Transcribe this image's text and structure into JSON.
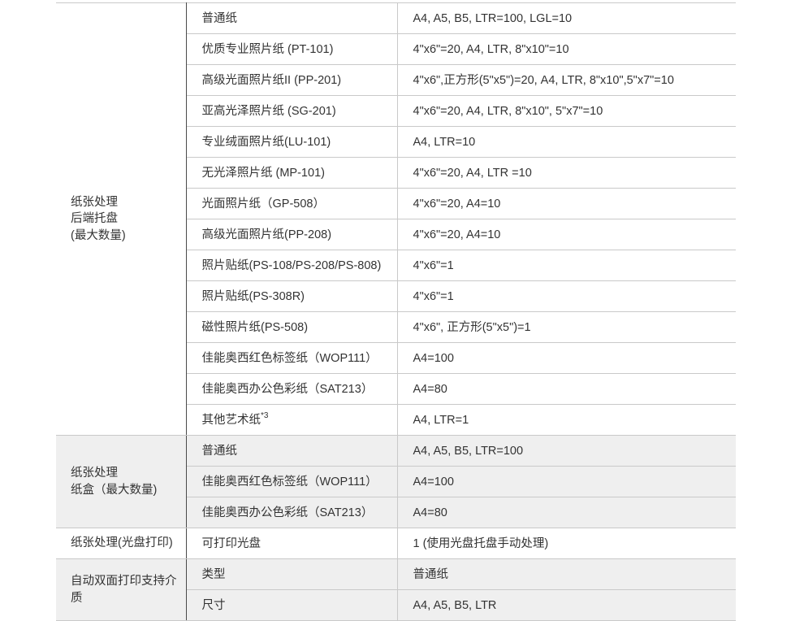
{
  "groups": [
    {
      "label_lines": [
        "纸张处理",
        "后端托盘",
        "(最大数量)"
      ],
      "rows": [
        {
          "item": "普通纸",
          "value": "A4, A5, B5, LTR=100, LGL=10"
        },
        {
          "item": "优质专业照片纸 (PT-101)",
          "value": "4\"x6\"=20, A4, LTR, 8\"x10\"=10"
        },
        {
          "item": "高级光面照片纸II (PP-201)",
          "value": "4\"x6\",正方形(5\"x5\")=20, A4, LTR,  8\"x10\",5\"x7\"=10"
        },
        {
          "item": "亚高光泽照片纸 (SG-201)",
          "value": "4\"x6\"=20, A4, LTR, 8\"x10\", 5\"x7\"=10"
        },
        {
          "item": "专业绒面照片纸(LU-101)",
          "value": "A4, LTR=10"
        },
        {
          "item": "无光泽照片纸 (MP-101)",
          "value": "4\"x6\"=20, A4, LTR =10"
        },
        {
          "item": "光面照片纸（GP-508）",
          "value": "4\"x6\"=20, A4=10"
        },
        {
          "item": "高级光面照片纸(PP-208)",
          "value": "4\"x6\"=20, A4=10"
        },
        {
          "item": "照片贴纸(PS-108/PS-208/PS-808)",
          "value": "4\"x6\"=1"
        },
        {
          "item": "照片贴纸(PS-308R)",
          "value": "4\"x6\"=1"
        },
        {
          "item": "磁性照片纸(PS-508)",
          "value": "4\"x6\", 正方形(5\"x5\")=1"
        },
        {
          "item": "佳能奥西红色标签纸（WOP111）",
          "value": "A4=100"
        },
        {
          "item": "佳能奥西办公色彩纸（SAT213）",
          "value": "A4=80"
        },
        {
          "item": "其他艺术纸",
          "item_sup": "*3",
          "value": "A4, LTR=1"
        }
      ]
    },
    {
      "label_lines": [
        "纸张处理",
        "纸盒（最大数量)"
      ],
      "rows": [
        {
          "item": "普通纸",
          "value": "A4, A5, B5, LTR=100"
        },
        {
          "item": "佳能奥西红色标签纸（WOP111）",
          "value": "A4=100"
        },
        {
          "item": "佳能奥西办公色彩纸（SAT213）",
          "value": "A4=80"
        }
      ]
    },
    {
      "label_lines": [
        "纸张处理(光盘打印)"
      ],
      "rows": [
        {
          "item": "可打印光盘",
          "value": "1 (使用光盘托盘手动处理)"
        }
      ]
    },
    {
      "label_lines": [
        "自动双面打印支持介",
        "质"
      ],
      "rows": [
        {
          "item": "类型",
          "value": "普通纸"
        },
        {
          "item": "尺寸",
          "value": "A4, A5, B5, LTR"
        }
      ]
    }
  ],
  "colors": {
    "shaded_row": "#efefef",
    "text": "#333333",
    "row_divider": "#c9c9c9",
    "group_divider": "#4a4a4a"
  }
}
